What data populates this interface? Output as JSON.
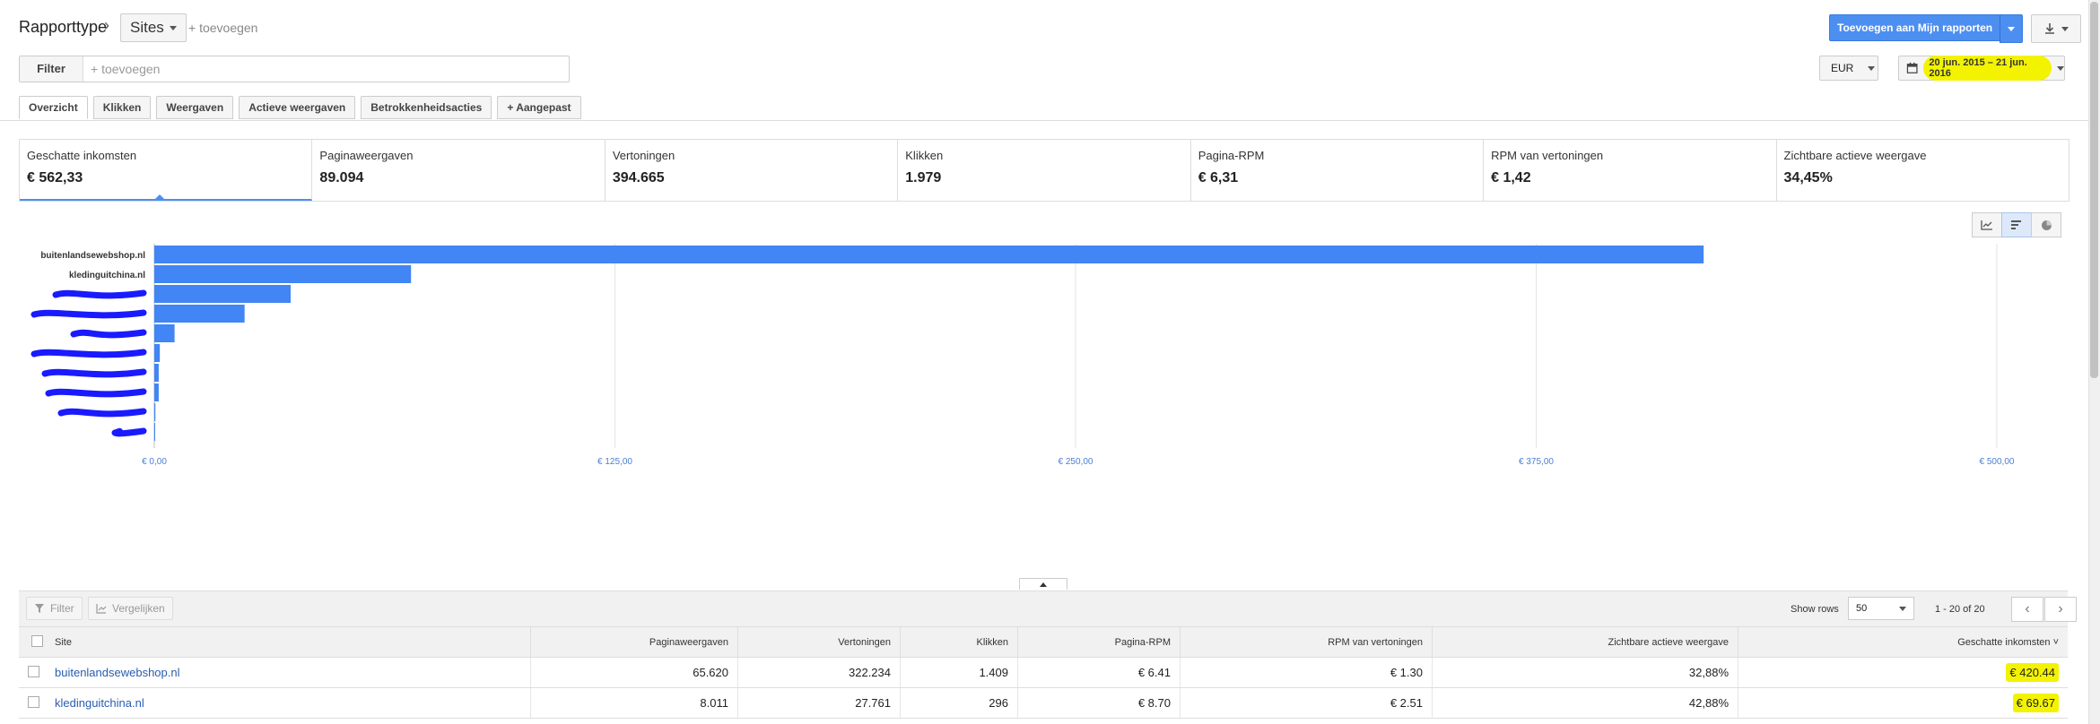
{
  "header": {
    "breadcrumb": "Rapporttype",
    "separator": "›",
    "dimension": "Sites",
    "add_dimension": "+ toevoegen",
    "add_to_reports": "Toevoegen aan Mijn rapporten"
  },
  "filter": {
    "label": "Filter",
    "placeholder": "+ toevoegen"
  },
  "currency": "EUR",
  "date_range": "20 jun. 2015 – 21 jun. 2016",
  "tabs": [
    "Overzicht",
    "Klikken",
    "Weergaven",
    "Actieve weergaven",
    "Betrokkenheidsacties",
    "+ Aangepast"
  ],
  "metrics": [
    {
      "label": "Geschatte inkomsten",
      "value": "€ 562,33"
    },
    {
      "label": "Paginaweergaven",
      "value": "89.094"
    },
    {
      "label": "Vertoningen",
      "value": "394.665"
    },
    {
      "label": "Klikken",
      "value": "1.979"
    },
    {
      "label": "Pagina-RPM",
      "value": "€ 6,31"
    },
    {
      "label": "RPM van vertoningen",
      "value": "€ 1,42"
    },
    {
      "label": "Zichtbare actieve weergave",
      "value": "34,45%"
    }
  ],
  "chart_data": {
    "type": "bar",
    "orientation": "horizontal",
    "categories": [
      "buitenlandsewebshop.nl",
      "kledinguitchina.nl",
      "",
      "",
      "",
      "",
      "",
      "",
      "",
      ""
    ],
    "values": [
      420.44,
      69.67,
      37.0,
      24.5,
      5.5,
      1.5,
      1.2,
      1.2,
      0.3,
      0.2
    ],
    "x_ticks": [
      "€ 0,00",
      "€ 125,00",
      "€ 250,00",
      "€ 375,00",
      "€ 500,00"
    ],
    "xlim": [
      0,
      500
    ],
    "grid": true,
    "bar_color": "#4285f4",
    "redaction_color": "#1a1aff"
  },
  "toolbar": {
    "filter": "Filter",
    "compare": "Vergelijken",
    "show_rows_label": "Show rows",
    "rows": "50",
    "range": "1 - 20 of 20"
  },
  "table": {
    "columns": [
      "Site",
      "Paginaweergaven",
      "Vertoningen",
      "Klikken",
      "Pagina-RPM",
      "RPM van vertoningen",
      "Zichtbare actieve weergave",
      "Geschatte inkomsten ˅"
    ],
    "rows": [
      {
        "site": "buitenlandsewebshop.nl",
        "pageviews": "65.620",
        "impressions": "322.234",
        "clicks": "1.409",
        "page_rpm": "€ 6.41",
        "imp_rpm": "€ 1.30",
        "viewable": "32,88%",
        "earnings": "€ 420.44"
      },
      {
        "site": "kledinguitchina.nl",
        "pageviews": "8.011",
        "impressions": "27.761",
        "clicks": "296",
        "page_rpm": "€ 8.70",
        "imp_rpm": "€ 2.51",
        "viewable": "42,88%",
        "earnings": "€ 69.67"
      }
    ]
  },
  "colors": {
    "accent": "#4d8ff0",
    "highlight": "#f3f300",
    "link": "#2a5db0"
  }
}
